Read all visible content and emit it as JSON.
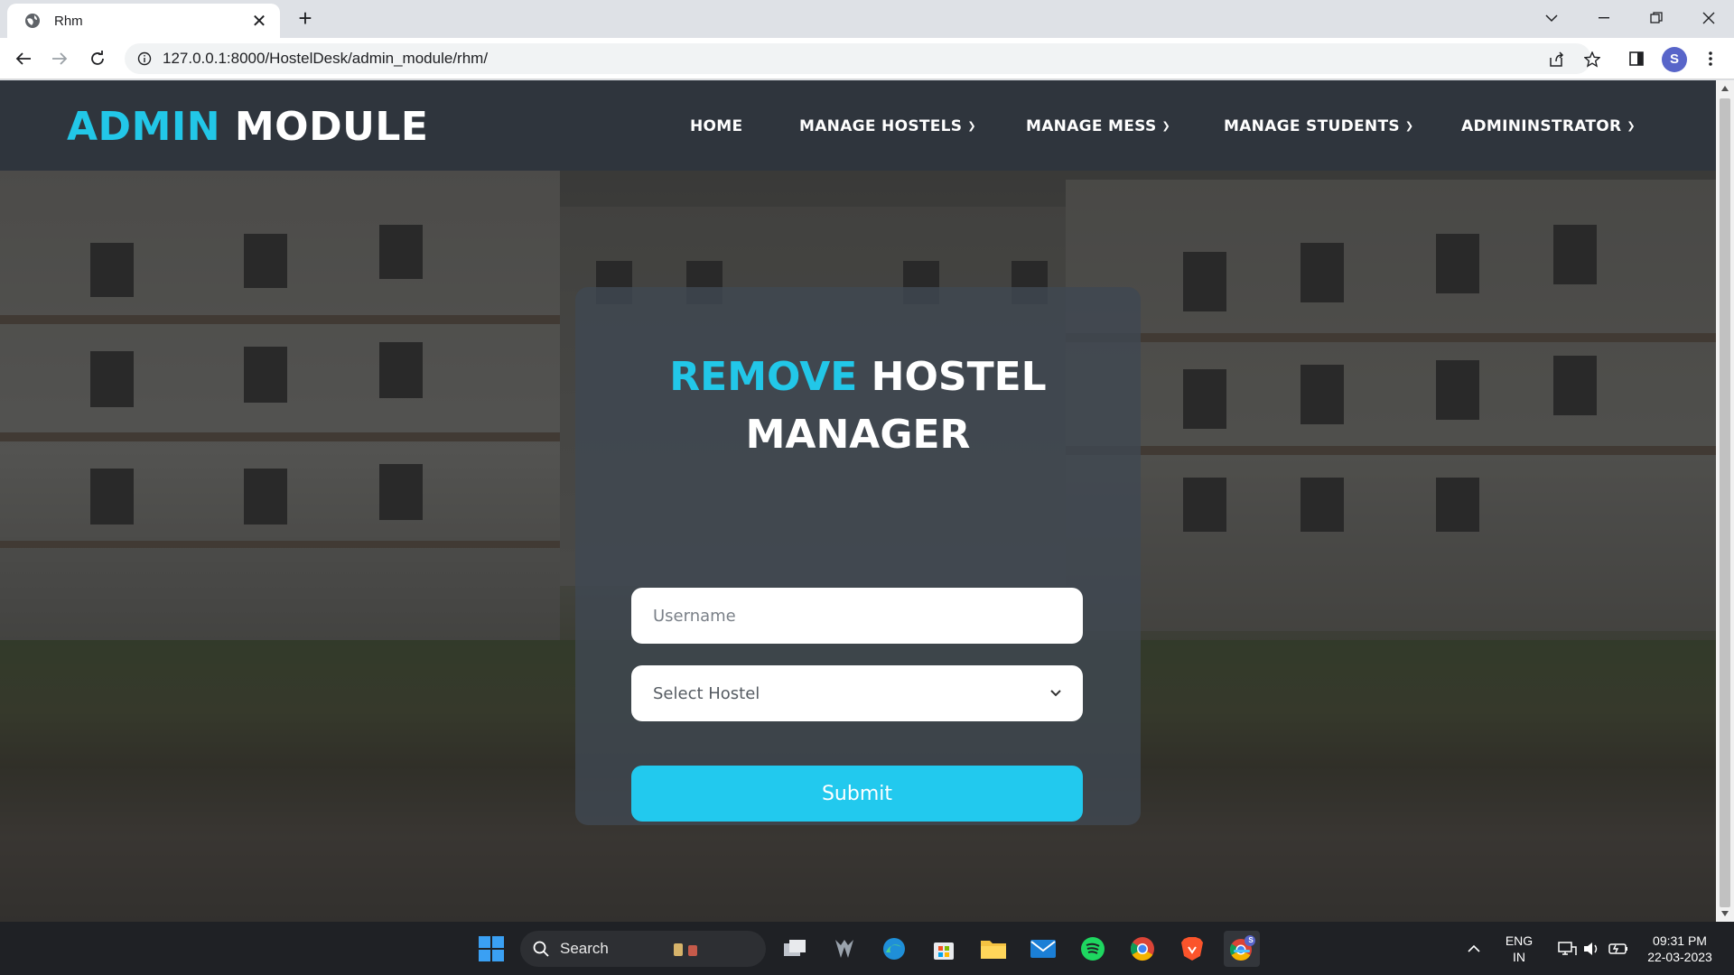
{
  "browser": {
    "tab_title": "Rhm",
    "new_tab": "+",
    "close_tab": "✕",
    "url": "127.0.0.1:8000/HostelDesk/admin_module/rhm/",
    "profile_initial": "S"
  },
  "header": {
    "brand_accent": "ADMIN",
    "brand_rest": "MODULE",
    "menu": [
      {
        "label": "HOME"
      },
      {
        "label": "MANAGE HOSTELS"
      },
      {
        "label": "MANAGE MESS"
      },
      {
        "label": "MANAGE STUDENTS"
      },
      {
        "label": "ADMININSTRATOR"
      }
    ]
  },
  "form": {
    "title_accent": "REMOVE",
    "title_white_1": "HOSTEL",
    "title_white_2": "MANAGER",
    "username_placeholder": "Username",
    "select_value": "Select Hostel",
    "submit_label": "Submit"
  },
  "taskbar": {
    "search_label": "Search",
    "lang_1": "ENG",
    "lang_2": "IN",
    "time": "09:31 PM",
    "date": "22-03-2023",
    "chrome_badge": "S"
  },
  "colors": {
    "accent": "#22c7e8",
    "header_bg": "#2f353d",
    "submit_bg": "#22c9ee"
  }
}
